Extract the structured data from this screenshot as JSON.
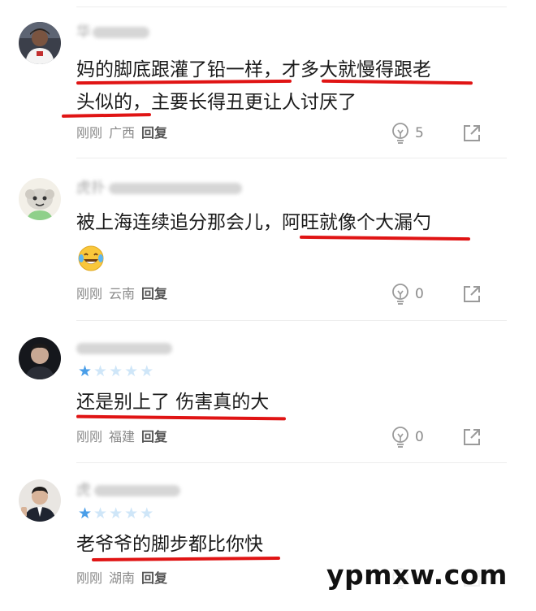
{
  "comments": [
    {
      "username": "华",
      "rating": null,
      "lines": [
        "妈的脚底跟灌了铅一样，才多大就慢得跟老",
        "头似的，主要长得丑更让人讨厌了"
      ],
      "emoji": null,
      "meta": {
        "time": "刚刚",
        "region": "广西",
        "reply": "回复"
      },
      "likes": "5"
    },
    {
      "username": "虎扑",
      "rating": null,
      "lines": [
        "被上海连续追分那会儿，阿旺就像个大漏勺"
      ],
      "emoji": "laugh-cry-emoji",
      "meta": {
        "time": "刚刚",
        "region": "云南",
        "reply": "回复"
      },
      "likes": "0"
    },
    {
      "username": "",
      "rating": {
        "score": 1,
        "max": 5
      },
      "lines": [
        "还是别上了 伤害真的大"
      ],
      "emoji": null,
      "meta": {
        "time": "刚刚",
        "region": "福建",
        "reply": "回复"
      },
      "likes": "0"
    },
    {
      "username": "虎",
      "rating": {
        "score": 1,
        "max": 5
      },
      "lines": [
        "老爷爷的脚步都比你快"
      ],
      "emoji": null,
      "meta": {
        "time": "刚刚",
        "region": "湖南",
        "reply": "回复"
      },
      "likes": ""
    }
  ],
  "icons": {
    "like": "lightbulb-like-icon",
    "share": "share-icon"
  },
  "colors": {
    "underline": "#e01414",
    "star_filled": "#4a9ee8",
    "star_empty": "#cfe6f8",
    "meta_text": "#8a8a8a"
  },
  "watermark": "ypmxw.com"
}
